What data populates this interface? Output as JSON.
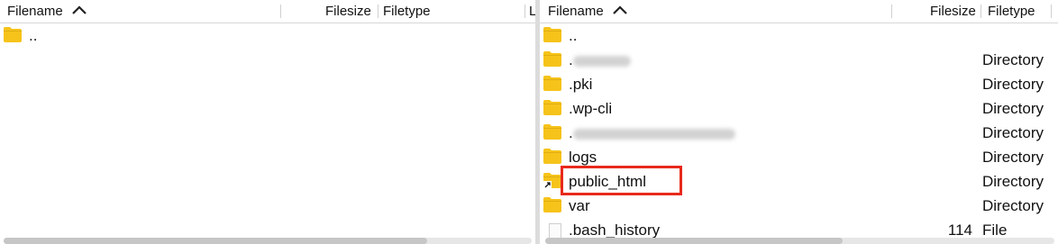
{
  "left_pane": {
    "headers": {
      "filename": "Filename",
      "filesize": "Filesize",
      "filetype": "Filetype",
      "lastmodified": "L"
    },
    "rows": [
      {
        "name": "..",
        "size": "",
        "type": "",
        "icon": "folder-icon"
      }
    ]
  },
  "right_pane": {
    "headers": {
      "filename": "Filename",
      "filesize": "Filesize",
      "filetype": "Filetype"
    },
    "rows": [
      {
        "name": "..",
        "size": "",
        "type": "",
        "icon": "folder-icon"
      },
      {
        "name": ".",
        "size": "",
        "type": "Directory",
        "icon": "folder-icon"
      },
      {
        "name": ".pki",
        "size": "",
        "type": "Directory",
        "icon": "folder-icon"
      },
      {
        "name": ".wp-cli",
        "size": "",
        "type": "Directory",
        "icon": "folder-icon"
      },
      {
        "name": ".",
        "size": "",
        "type": "Directory",
        "icon": "folder-icon"
      },
      {
        "name": "logs",
        "size": "",
        "type": "Directory",
        "icon": "folder-icon"
      },
      {
        "name": "public_html",
        "size": "",
        "type": "Directory",
        "icon": "folder-alias-icon"
      },
      {
        "name": "var",
        "size": "",
        "type": "Directory",
        "icon": "folder-icon"
      },
      {
        "name": ".bash_history",
        "size": "114",
        "type": "File",
        "icon": "file-icon"
      }
    ]
  },
  "colors": {
    "folder": "#f6c31a",
    "highlight": "#e8291c",
    "separator": "#d0d0d0"
  }
}
